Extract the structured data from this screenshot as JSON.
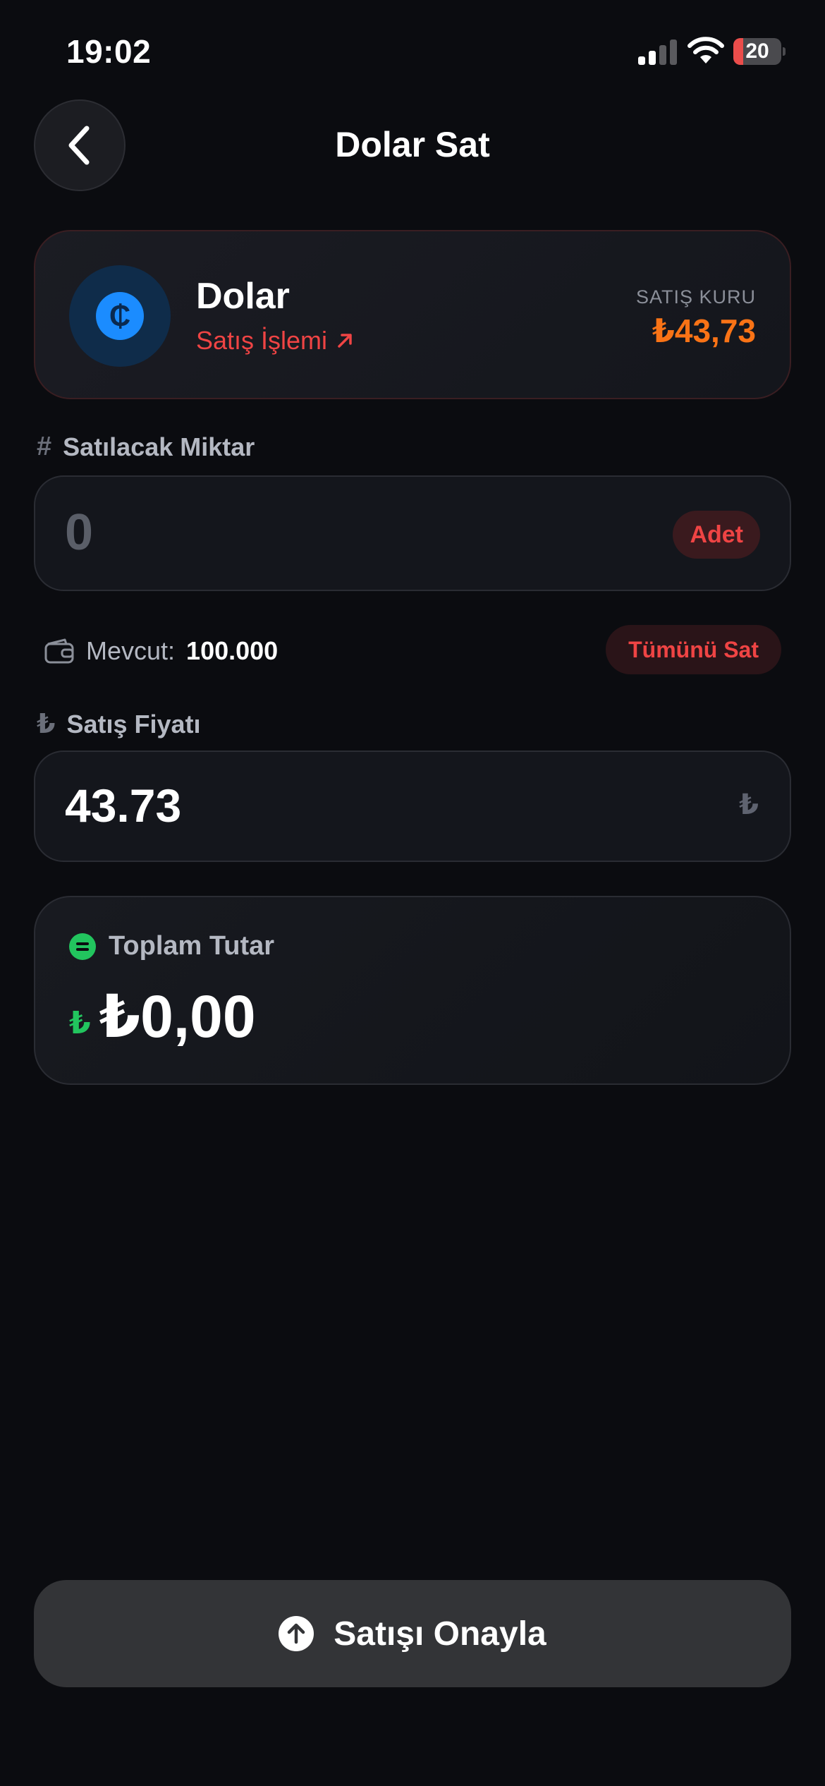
{
  "status_bar": {
    "time": "19:02",
    "battery_level": "20",
    "battery_fraction": 0.2,
    "icons": [
      "signal-icon",
      "wifi-icon",
      "battery-icon"
    ]
  },
  "header": {
    "title": "Dolar Sat",
    "back_icon": "chevron-left-icon"
  },
  "asset": {
    "name": "Dolar",
    "subtitle": "Satış İşlemi",
    "coin_glyph": "₵",
    "rate_label": "SATIŞ KURU",
    "rate_value": "₺43,73"
  },
  "quantity": {
    "label_glyph": "#",
    "label": "Satılacak Miktar",
    "value": "0",
    "unit": "Adet"
  },
  "available": {
    "label": "Mevcut:",
    "value": "100.000",
    "sell_all_label": "Tümünü Sat"
  },
  "price": {
    "label_glyph": "₺",
    "label": "Satış Fiyatı",
    "value": "43.73",
    "suffix": "₺"
  },
  "total": {
    "label": "Toplam Tutar",
    "currency_glyph": "₺",
    "value": "₺0,00"
  },
  "confirm": {
    "label": "Satışı Onayla"
  },
  "colors": {
    "background": "#0b0c10",
    "sell_accent": "#ef4444",
    "rate_accent": "#f97316",
    "total_accent": "#22c55e",
    "coin_blue": "#1b8cff"
  }
}
